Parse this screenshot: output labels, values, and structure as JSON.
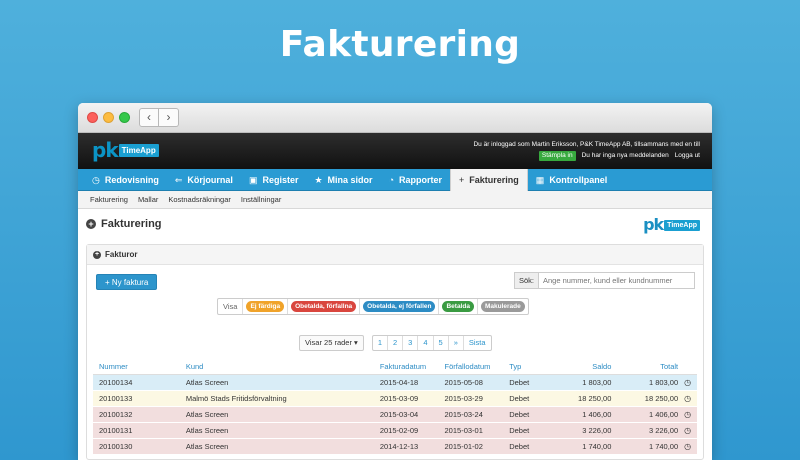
{
  "hero": {
    "title": "Fakturering"
  },
  "browser": {
    "back_label": "‹",
    "forward_label": "›"
  },
  "app": {
    "logo_pk": "pk",
    "logo_timeapp": "TimeApp",
    "user_line": "Du är inloggad som Martin Eriksson, P&K TimeApp AB, tillsammans med en till",
    "stamp_label": "Stämpla in",
    "messages_label": "Du har inga nya meddelanden",
    "logout_label": "Logga ut"
  },
  "tabs": [
    {
      "label": "Redovisning",
      "icon": "clock-icon",
      "glyph": "◷"
    },
    {
      "label": "Körjournal",
      "icon": "car-icon",
      "glyph": "⇐"
    },
    {
      "label": "Register",
      "icon": "inbox-icon",
      "glyph": "▣"
    },
    {
      "label": "Mina sidor",
      "icon": "star-icon",
      "glyph": "★"
    },
    {
      "label": "Rapporter",
      "icon": "pie-chart-icon",
      "glyph": "◔"
    },
    {
      "label": "Fakturering",
      "icon": "plus-circle-icon",
      "glyph": "+"
    },
    {
      "label": "Kontrollpanel",
      "icon": "table-icon",
      "glyph": "▦"
    }
  ],
  "subnav": [
    "Fakturering",
    "Mallar",
    "Kostnadsräkningar",
    "Inställningar"
  ],
  "page": {
    "title": "Fakturering"
  },
  "panel": {
    "title": "Fakturor",
    "new_button": "+ Ny faktura",
    "search_label": "Sök:",
    "search_placeholder": "Ange nummer, kund eller kundnummer"
  },
  "filters": {
    "visa": "Visa",
    "pills": [
      {
        "label": "Ej färdiga",
        "color": "#f0a32a"
      },
      {
        "label": "Obetalda, förfallna",
        "color": "#d9463e"
      },
      {
        "label": "Obetalda, ej förfallen",
        "color": "#2d8cc4"
      },
      {
        "label": "Betalda",
        "color": "#3a9b42"
      },
      {
        "label": "Makulerade",
        "color": "#9a9a9a"
      }
    ]
  },
  "pager": {
    "rows_label": "Visar 25 rader ▾",
    "pages": [
      "1",
      "2",
      "3",
      "4",
      "5",
      "»",
      "Sista"
    ]
  },
  "table": {
    "headers": [
      "Nummer",
      "Kund",
      "Fakturadatum",
      "Förfallodatum",
      "Typ",
      "Saldo",
      "Totalt"
    ],
    "rows": [
      {
        "status": "blue",
        "nummer": "20100134",
        "kund": "Atlas Screen",
        "fakturadatum": "2015-04-18",
        "forfallodatum": "2015-05-08",
        "typ": "Debet",
        "saldo": "1 803,00",
        "totalt": "1 803,00"
      },
      {
        "status": "yellow",
        "nummer": "20100133",
        "kund": "Malmö Stads Fritidsförvaltning",
        "fakturadatum": "2015-03-09",
        "forfallodatum": "2015-03-29",
        "typ": "Debet",
        "saldo": "18 250,00",
        "totalt": "18 250,00"
      },
      {
        "status": "red",
        "nummer": "20100132",
        "kund": "Atlas Screen",
        "fakturadatum": "2015-03-04",
        "forfallodatum": "2015-03-24",
        "typ": "Debet",
        "saldo": "1 406,00",
        "totalt": "1 406,00"
      },
      {
        "status": "red",
        "nummer": "20100131",
        "kund": "Atlas Screen",
        "fakturadatum": "2015-02-09",
        "forfallodatum": "2015-03-01",
        "typ": "Debet",
        "saldo": "3 226,00",
        "totalt": "3 226,00"
      },
      {
        "status": "red",
        "nummer": "20100130",
        "kund": "Atlas Screen",
        "fakturadatum": "2014-12-13",
        "forfallodatum": "2015-01-02",
        "typ": "Debet",
        "saldo": "1 740,00",
        "totalt": "1 740,00"
      }
    ]
  }
}
